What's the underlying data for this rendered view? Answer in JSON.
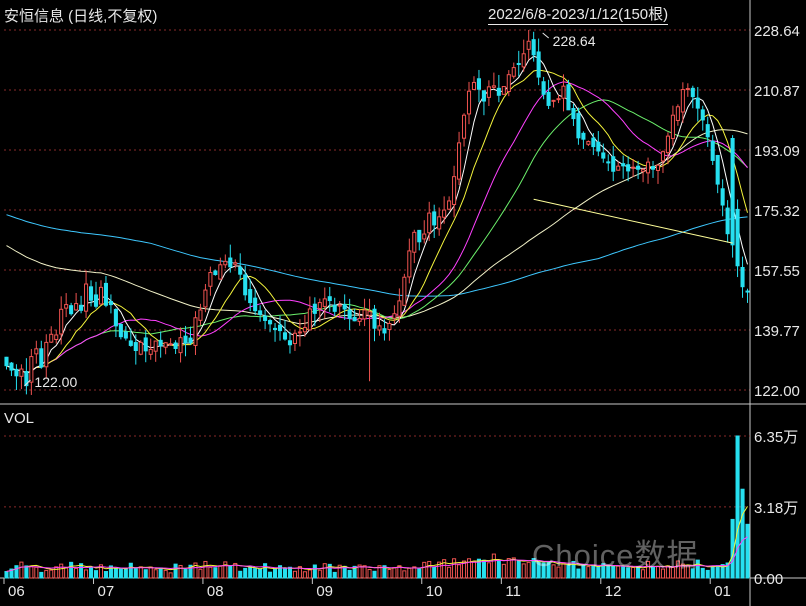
{
  "header": {
    "stock_name": "安恒信息 (日线,不复权)",
    "date_range": "2022/6/8-2023/1/12(150根)"
  },
  "volume_pane": {
    "label": "VOL"
  },
  "watermark": "Choice数据",
  "colors": {
    "up": "#ef5350",
    "down": "#26e0f0",
    "ma5": "#ffffff",
    "ma10": "#f5f53c",
    "ma20": "#ff40ff",
    "ma30": "#6cf06c",
    "ma60": "#f2f2c8",
    "ma120": "#3ec8ff",
    "trendline": "#ffff99",
    "grid": "#8a2a2a"
  },
  "chart_data": [
    {
      "type": "candlestick",
      "title": "安恒信息 (日线,不复权)",
      "period": "2022/6/8-2023/1/12",
      "bars": 150,
      "y_ticks": [
        "228.64",
        "210.87",
        "193.09",
        "175.32",
        "157.55",
        "139.77",
        "122.00"
      ],
      "ylim": [
        122.0,
        228.64
      ],
      "x_ticks": [
        "06",
        "07",
        "08",
        "09",
        "10",
        "11",
        "12",
        "01"
      ],
      "high_annotation": "228.64",
      "low_annotation": "122.00",
      "grid": true,
      "ohlc_source": "approximated from image",
      "trendline": {
        "from_month": "11",
        "to": "01",
        "y_start": 178.5,
        "y_end": 165.5
      },
      "closes": [
        129.2,
        127.9,
        126.2,
        128.2,
        123.3,
        131.9,
        134.2,
        128.8,
        136.1,
        138.5,
        138.3,
        145.9,
        147.3,
        144.6,
        147.6,
        145.6,
        153.4,
        148.6,
        146.8,
        152.4,
        147.1,
        147.3,
        141.0,
        137.8,
        137.4,
        135.2,
        133.7,
        136.1,
        133.6,
        134.0,
        136.5,
        135.1,
        136.0,
        135.7,
        134.3,
        137.5,
        135.9,
        136.0,
        143.4,
        145.7,
        151.6,
        156.8,
        156.2,
        159.1,
        160.1,
        158.5,
        159.7,
        156.3,
        150.2,
        147.9,
        145.5,
        144.4,
        142.6,
        141.6,
        139.9,
        139.6,
        137.1,
        135.4,
        138.8,
        139.2,
        140.5,
        146.0,
        144.7,
        147.9,
        149.0,
        148.5,
        145.3,
        147.2,
        146.0,
        143.2,
        142.5,
        143.2,
        145.7,
        145.2,
        140.3,
        141.0,
        138.9,
        141.7,
        144.6,
        148.4,
        155.4,
        163.2,
        168.7,
        165.9,
        168.2,
        174.4,
        170.9,
        173.3,
        175.3,
        178.0,
        185.2,
        195.2,
        203.4,
        210.5,
        213.1,
        211.1,
        207.6,
        211.8,
        212.1,
        209.3,
        211.9,
        215.4,
        217.5,
        218.7,
        221.6,
        225.3,
        221.3,
        214.7,
        209.6,
        206.3,
        207.8,
        208.3,
        212.0,
        205.0,
        202.4,
        196.7,
        196.3,
        195.6,
        194.1,
        192.8,
        190.7,
        189.5,
        186.8,
        188.3,
        188.4,
        186.9,
        188.0,
        187.4,
        187.3,
        189.5,
        187.4,
        188.6,
        192.6,
        197.2,
        203.4,
        205.9,
        211.0,
        211.3,
        208.9,
        205.5,
        202.0,
        197.0,
        190.0,
        183.0,
        176.8,
        168.3,
        165.0,
        158.8,
        152.6,
        151.3
      ],
      "price_series_available": false
    },
    {
      "type": "bar",
      "title": "VOL",
      "y_ticks": [
        "6.35万",
        "3.18万",
        "0.00"
      ],
      "ylim": [
        0,
        6.35
      ],
      "unit": "万",
      "values_source": "approximated from image",
      "values": [
        0.29,
        0.4,
        0.55,
        0.71,
        0.54,
        0.53,
        0.48,
        0.25,
        0.34,
        0.35,
        0.5,
        0.62,
        0.45,
        0.7,
        0.43,
        0.64,
        0.36,
        0.48,
        0.33,
        0.59,
        0.29,
        0.54,
        0.42,
        0.4,
        0.41,
        0.66,
        0.42,
        0.5,
        0.37,
        0.49,
        0.37,
        0.45,
        0.34,
        0.23,
        0.62,
        0.56,
        0.39,
        0.57,
        0.67,
        0.39,
        0.74,
        0.48,
        0.46,
        0.55,
        0.72,
        0.55,
        0.65,
        0.3,
        0.43,
        0.51,
        0.42,
        0.38,
        0.64,
        0.26,
        0.4,
        0.55,
        0.45,
        0.48,
        0.3,
        0.51,
        0.28,
        0.36,
        0.58,
        0.35,
        0.64,
        0.61,
        0.25,
        0.57,
        0.52,
        0.34,
        0.52,
        0.58,
        0.55,
        0.38,
        0.3,
        0.55,
        0.55,
        0.38,
        0.47,
        0.55,
        0.32,
        0.45,
        0.5,
        0.4,
        0.7,
        0.74,
        0.48,
        0.71,
        0.82,
        0.48,
        0.86,
        0.59,
        0.76,
        0.86,
        0.73,
        0.84,
        0.79,
        0.68,
        1.07,
        0.76,
        0.61,
        0.87,
        0.9,
        0.76,
        0.63,
        0.7,
        0.87,
        0.72,
        0.67,
        0.7,
        0.59,
        0.49,
        0.68,
        0.59,
        0.74,
        0.4,
        0.59,
        0.51,
        0.56,
        0.49,
        0.64,
        0.56,
        0.52,
        0.53,
        0.49,
        0.46,
        0.47,
        0.47,
        0.37,
        0.74,
        0.52,
        0.52,
        0.4,
        0.54,
        0.47,
        0.76,
        0.62,
        0.55,
        0.41,
        0.8,
        0.43,
        0.34,
        0.53,
        0.55,
        0.6,
        0.67,
        2.62,
        6.35,
        3.97,
        2.4
      ]
    }
  ]
}
